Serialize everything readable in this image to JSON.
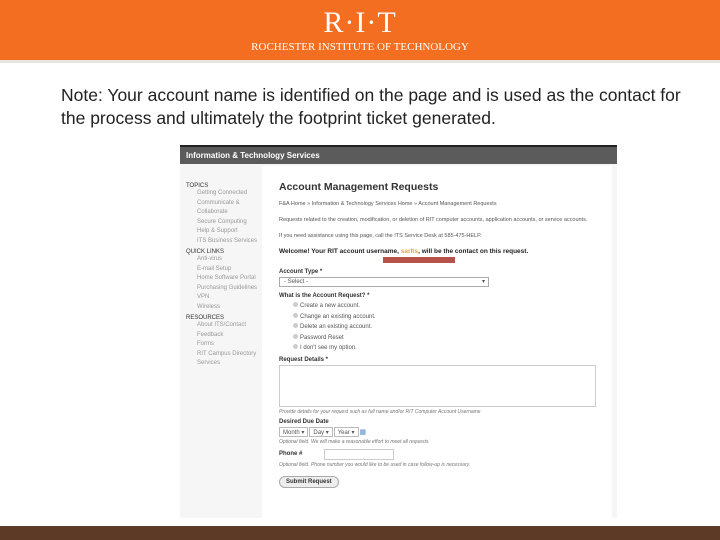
{
  "header": {
    "logo": "R·I·T",
    "subtitle": "ROCHESTER INSTITUTE OF TECHNOLOGY"
  },
  "note": "Note:  Your account name is identified on the page and is used as the contact for the process and ultimately the footprint ticket generated.",
  "screenshot": {
    "bar_title": "Information & Technology Services",
    "sidebar": [
      {
        "heading": "TOPICS",
        "items": [
          "Getting Connected",
          "Communicate & Collaborate",
          "Secure Computing",
          "Help & Support",
          "ITS Business Services"
        ]
      },
      {
        "heading": "QUICK LINKS",
        "items": [
          "Anti-virus",
          "E-mail Setup",
          "Home Software Portal",
          "Purchasing Guidelines",
          "VPN",
          "Wireless"
        ]
      },
      {
        "heading": "RESOURCES",
        "items": [
          "About ITS/Contact",
          "Feedback",
          "Forms",
          "RIT Campus Directory",
          "Services"
        ]
      }
    ],
    "title": "Account Management Requests",
    "breadcrumb": "F&A Home » Information & Technology Services Home » Account Management Requests",
    "intro": "Requests related to the creation, modification, or deletion of RIT computer accounts, application accounts, or service accounts.",
    "assist": "If you need assistance using this page, call the ITS Service Desk at 585-475-HELP.",
    "welcome_pre": "Welcome!  Your RIT account username, ",
    "username": "sarlts",
    "welcome_post": ", will be the contact on this request.",
    "account_type_label": "Account Type *",
    "account_type_value": "- Select -",
    "request_label": "What is the Account Request? *",
    "options": [
      "Create a new account.",
      "Change an existing account.",
      "Delete an existing account.",
      "Password Reset",
      "I don't see my option."
    ],
    "details_label": "Request Details *",
    "details_help": "Provide details for your request such as full name and/or RIT Computer Account Username",
    "due_label": "Desired Due Date",
    "month": "Month",
    "day": "Day",
    "year": "Year",
    "due_help": "Optional field. We will make a reasonable effort to meet all requests.",
    "phone_label": "Phone #",
    "phone_help": "Optional field. Phone number you would like to be used in case follow-up is necessary.",
    "submit": "Submit Request"
  }
}
